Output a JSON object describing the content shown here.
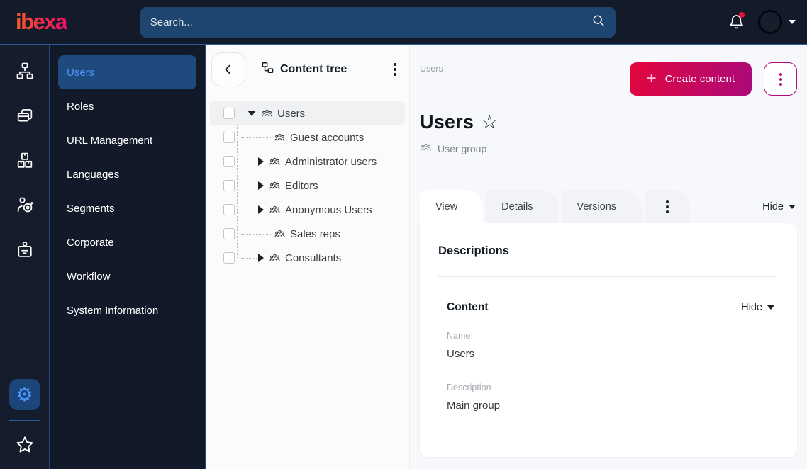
{
  "topbar": {
    "logo_text": "ibexa",
    "search": {
      "placeholder": "Search..."
    }
  },
  "icon_rail": {
    "icons": [
      "sitemap",
      "pages",
      "boxes",
      "audience",
      "badge",
      "settings",
      "bookmarks"
    ],
    "active_icon": "settings"
  },
  "sidebar": {
    "items": [
      {
        "label": "Users",
        "active": true
      },
      {
        "label": "Roles",
        "active": false
      },
      {
        "label": "URL Management",
        "active": false
      },
      {
        "label": "Languages",
        "active": false
      },
      {
        "label": "Segments",
        "active": false
      },
      {
        "label": "Corporate",
        "active": false
      },
      {
        "label": "Workflow",
        "active": false
      },
      {
        "label": "System Information",
        "active": false
      }
    ]
  },
  "content_tree": {
    "title": "Content tree",
    "items": [
      {
        "label": "Users",
        "level": 0,
        "expander": "expanded",
        "selected": true,
        "icon": "user-group"
      },
      {
        "label": "Guest accounts",
        "level": 1,
        "expander": "none",
        "selected": false,
        "icon": "user-group"
      },
      {
        "label": "Administrator users",
        "level": 1,
        "expander": "collapsed",
        "selected": false,
        "icon": "user-group"
      },
      {
        "label": "Editors",
        "level": 1,
        "expander": "collapsed",
        "selected": false,
        "icon": "user-group"
      },
      {
        "label": "Anonymous Users",
        "level": 1,
        "expander": "collapsed",
        "selected": false,
        "icon": "user-group"
      },
      {
        "label": "Sales reps",
        "level": 1,
        "expander": "none",
        "selected": false,
        "icon": "user-group"
      },
      {
        "label": "Consultants",
        "level": 1,
        "expander": "collapsed",
        "selected": false,
        "icon": "user-group"
      }
    ]
  },
  "main": {
    "breadcrumb": "Users",
    "create_content_label": "Create content",
    "title": "Users",
    "content_type": "User group",
    "tabs": [
      {
        "label": "View",
        "active": true
      },
      {
        "label": "Details",
        "active": false
      },
      {
        "label": "Versions",
        "active": false
      }
    ],
    "hide_toggle_label": "Hide",
    "panel": {
      "section_title": "Descriptions",
      "group_title": "Content",
      "group_hide_label": "Hide",
      "fields": [
        {
          "label": "Name",
          "value": "Users"
        },
        {
          "label": "Description",
          "value": "Main group"
        }
      ]
    }
  },
  "colors": {
    "topbar_bg": "#131a29",
    "search_bg": "#1e4470",
    "accent_blue": "#4b96ff",
    "active_item_bg": "#1f4a7e",
    "brand_gradient_start": "#e3063e",
    "brand_gradient_end": "#ab0979",
    "kebab_pink": "#b00a78",
    "notification_red": "#e8113c",
    "main_bg": "#f6f8fb"
  }
}
